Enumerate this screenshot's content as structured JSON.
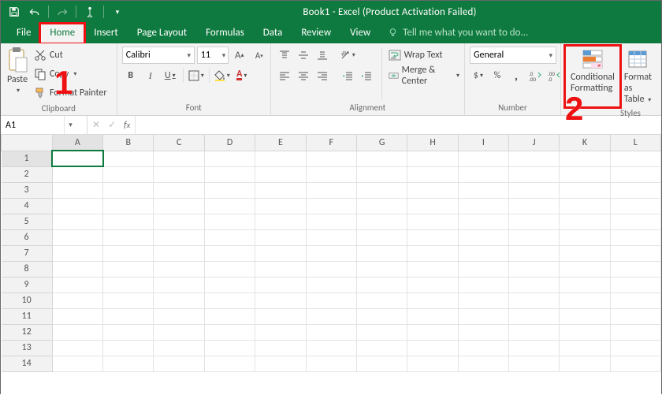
{
  "title": "Book1 - Excel (Product Activation Failed)",
  "qat": {
    "save": "save-icon",
    "undo": "undo-icon",
    "redo": "redo-icon",
    "touch": "touch-icon",
    "customize": "customize-icon"
  },
  "tabs": [
    "File",
    "Home",
    "Insert",
    "Page Layout",
    "Formulas",
    "Data",
    "Review",
    "View"
  ],
  "active_tab": "Home",
  "tell_me": "Tell me what you want to do...",
  "clipboard": {
    "paste": "Paste",
    "cut": "Cut",
    "copy": "Copy",
    "format_painter": "Format Painter",
    "label": "Clipboard"
  },
  "font": {
    "name": "Calibri",
    "size": "11",
    "label": "Font",
    "bold": "B",
    "italic": "I",
    "underline": "U",
    "grow": "A",
    "shrink": "A"
  },
  "alignment": {
    "wrap": "Wrap Text",
    "merge": "Merge & Center",
    "label": "Alignment"
  },
  "number": {
    "format": "General",
    "label": "Number",
    "currency": "$",
    "percent": "%",
    "comma": ",",
    "inc": "increase-decimals",
    "dec": "decrease-decimals"
  },
  "styles": {
    "cond": "Conditional",
    "cond2": "Formatting",
    "table": "Format as",
    "table2": "Table",
    "label": "Styles"
  },
  "namebox": "A1",
  "formula": "",
  "cols": [
    "A",
    "B",
    "C",
    "D",
    "E",
    "F",
    "G",
    "H",
    "I",
    "J",
    "K",
    "L"
  ],
  "rows": [
    "1",
    "2",
    "3",
    "4",
    "5",
    "6",
    "7",
    "8",
    "9",
    "10",
    "11",
    "12",
    "13",
    "14"
  ],
  "selected_cell": "A1",
  "annotations": {
    "one": "1",
    "two": "2"
  },
  "colors": {
    "accent": "#0f7a3f",
    "highlight": "#e11"
  }
}
